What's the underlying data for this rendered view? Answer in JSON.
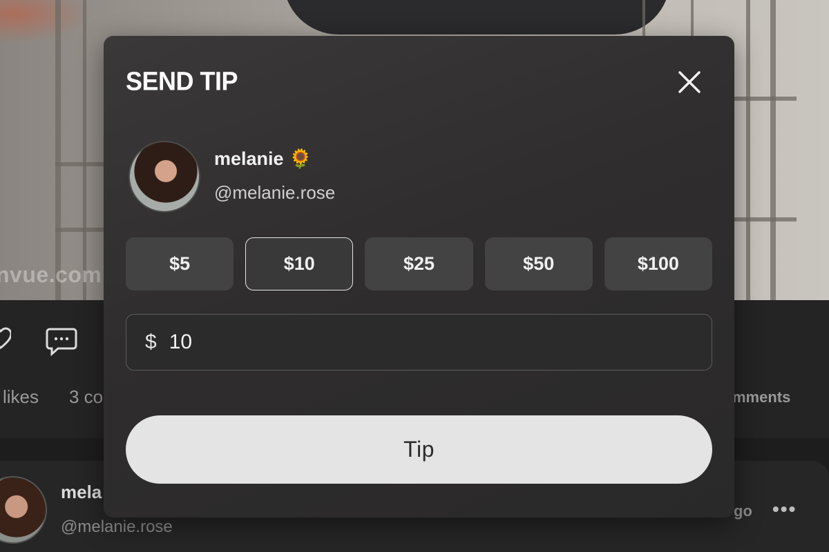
{
  "background": {
    "watermark": "nvue.com",
    "likes_label": "likes",
    "comments_left_label": "3 co",
    "comments_right_label": "mments",
    "post": {
      "name": "mela",
      "handle": "@melanie.rose",
      "time_ago": "go",
      "more_glyph": "•••"
    },
    "icons": [
      "heart-icon",
      "comment-icon"
    ]
  },
  "modal": {
    "title": "SEND TIP",
    "close_glyph": "✕",
    "creator": {
      "name": "melanie 🌻",
      "handle": "@melanie.rose"
    },
    "amounts": [
      "$5",
      "$10",
      "$25",
      "$50",
      "$100"
    ],
    "selected_amount": "$10",
    "input": {
      "currency": "$",
      "value": "10"
    },
    "tip_button": "Tip"
  },
  "colors": {
    "modal_bg": "#2f2d2d",
    "amount_bg": "#444343",
    "selected_border": "#e6e6e6",
    "tip_button_bg": "#e4e4e4"
  }
}
